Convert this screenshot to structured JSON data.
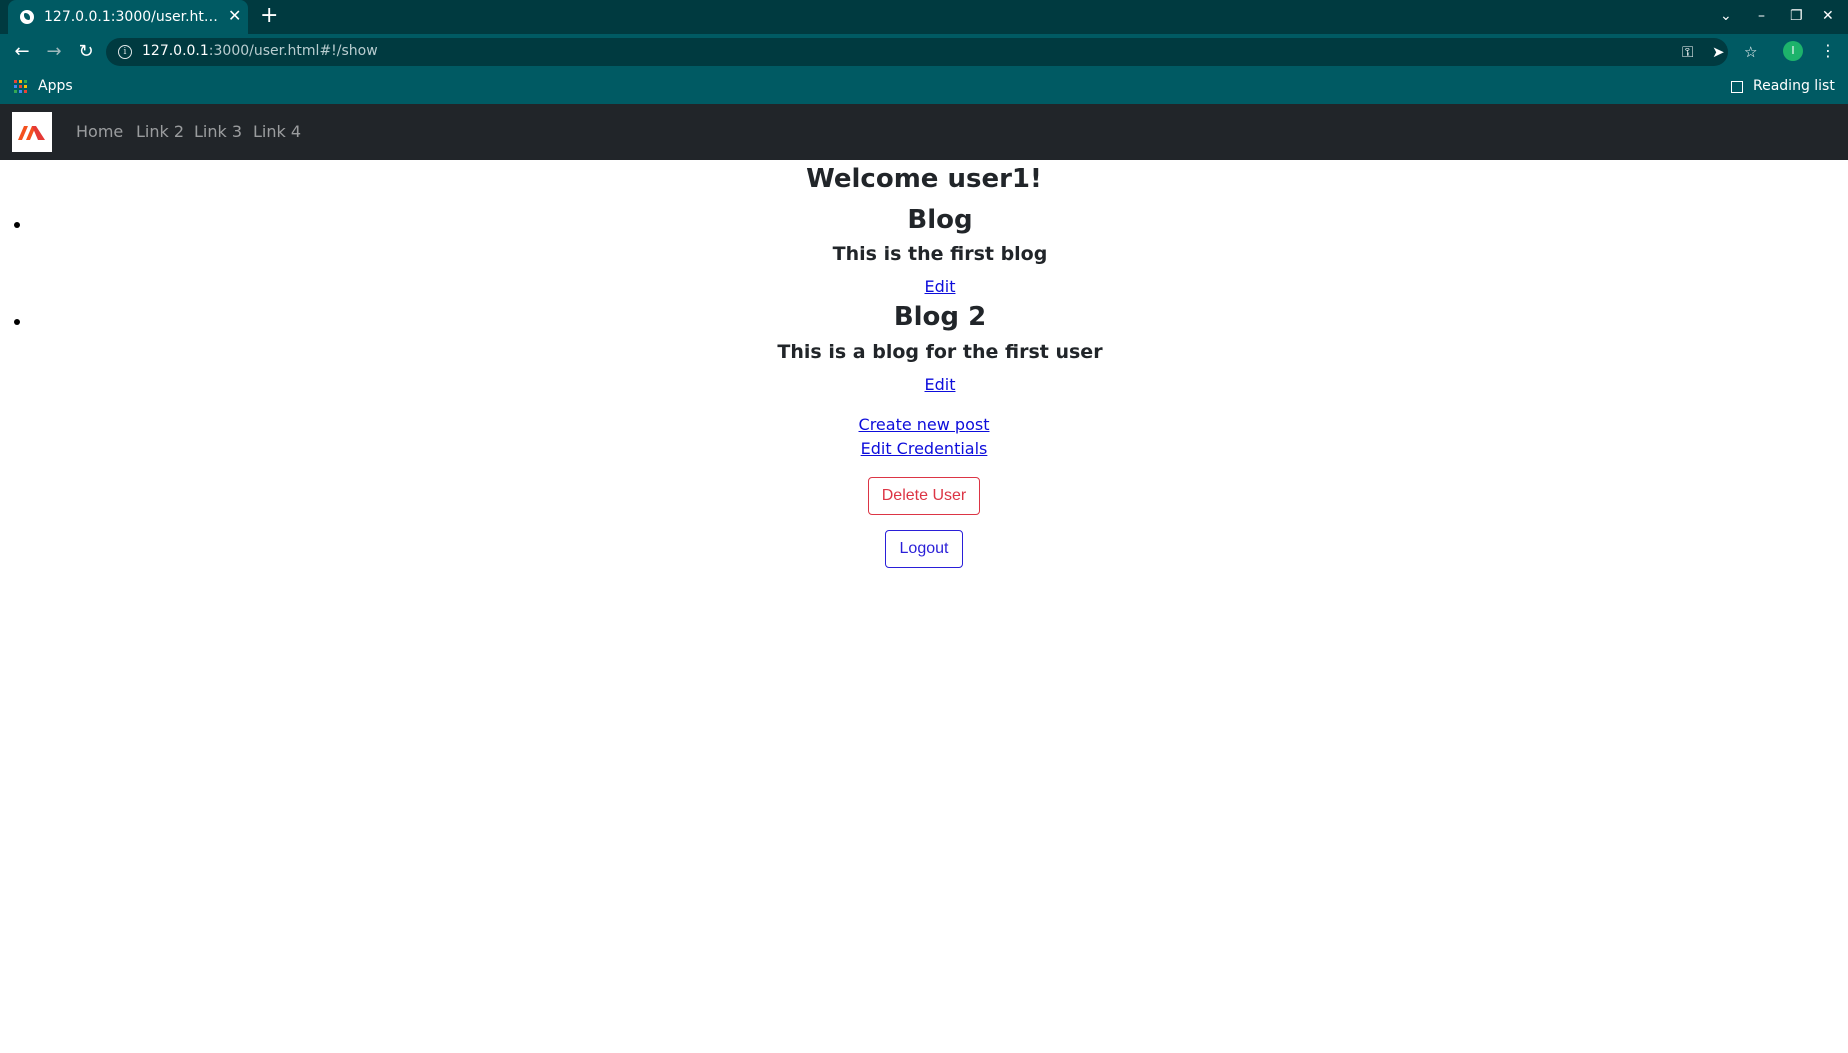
{
  "browser": {
    "tab_title": "127.0.0.1:3000/user.html#!/show",
    "new_tab_symbol": "+",
    "close_tab_symbol": "✕",
    "url_host": "127.0.0.1",
    "url_rest": ":3000/user.html#!/show",
    "profile_initial": "I",
    "bookmarks": {
      "apps_label": "Apps",
      "reading_list_label": "Reading list"
    }
  },
  "navbar": {
    "links": [
      "Home",
      "Link 2",
      "Link 3",
      "Link 4"
    ]
  },
  "page": {
    "welcome": "Welcome user1!",
    "blogs": [
      {
        "title": "Blog",
        "text": "This is the first blog",
        "edit_label": "Edit"
      },
      {
        "title": "Blog 2",
        "text": "This is a blog for the first user",
        "edit_label": "Edit"
      }
    ],
    "create_post_label": "Create new post",
    "edit_credentials_label": "Edit Credentials",
    "delete_user_label": "Delete User",
    "logout_label": "Logout"
  },
  "colors": {
    "browser_frame": "#003a40",
    "browser_toolbar": "#005a63",
    "navbar": "#212529",
    "danger": "#dc3545",
    "primary": "#2a1fd8",
    "link": "#0d0ddb"
  }
}
